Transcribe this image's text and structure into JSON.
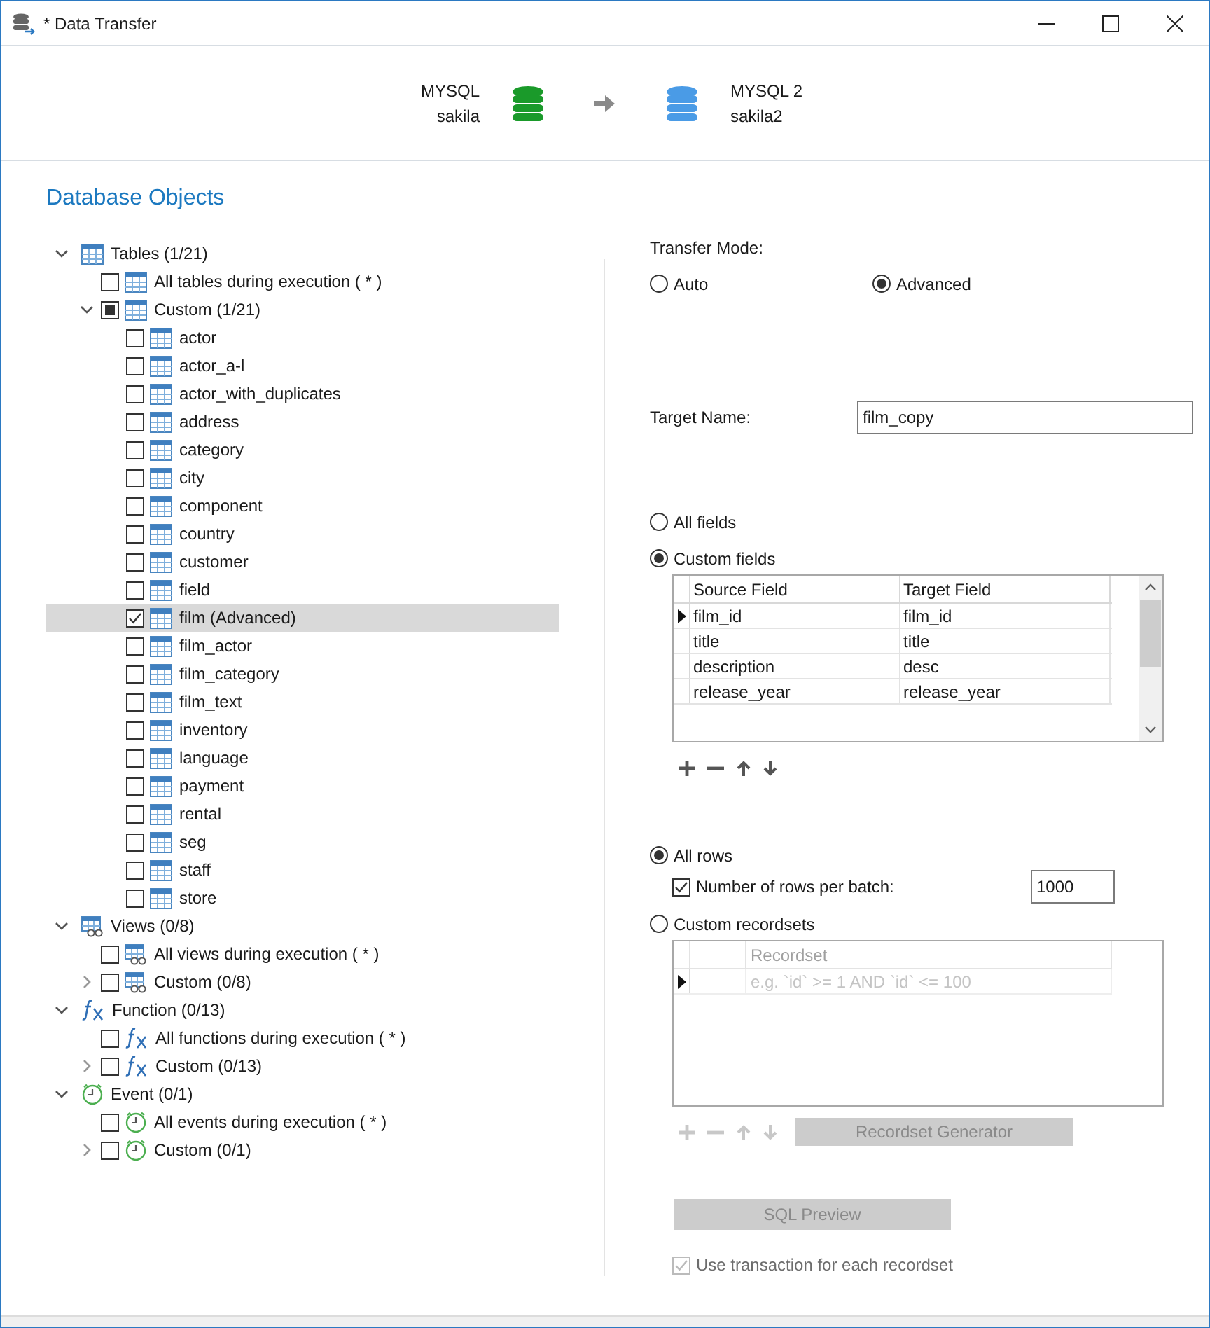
{
  "window": {
    "title": "* Data Transfer"
  },
  "connections": {
    "source": {
      "name": "MYSQL",
      "database": "sakila",
      "color": "#1a9a2a"
    },
    "target": {
      "name": "MYSQL 2",
      "database": "sakila2",
      "color": "#4a9be6"
    }
  },
  "objects": {
    "title": "Database Objects",
    "groups": [
      {
        "label": "Tables (1/21)",
        "kind": "table",
        "expanded": true,
        "children": [
          {
            "label": "All tables during execution ( * )",
            "checked": false,
            "indeterminate": false,
            "selected": false
          },
          {
            "label": "Custom (1/21)",
            "checked": false,
            "indeterminate": true,
            "selected": false,
            "expanded": true,
            "children": [
              {
                "label": "actor",
                "checked": false,
                "selected": false
              },
              {
                "label": "actor_a-l",
                "checked": false,
                "selected": false
              },
              {
                "label": "actor_with_duplicates",
                "checked": false,
                "selected": false
              },
              {
                "label": "address",
                "checked": false,
                "selected": false
              },
              {
                "label": "category",
                "checked": false,
                "selected": false
              },
              {
                "label": "city",
                "checked": false,
                "selected": false
              },
              {
                "label": "component",
                "checked": false,
                "selected": false
              },
              {
                "label": "country",
                "checked": false,
                "selected": false
              },
              {
                "label": "customer",
                "checked": false,
                "selected": false
              },
              {
                "label": "field",
                "checked": false,
                "selected": false
              },
              {
                "label": "film (Advanced)",
                "checked": true,
                "selected": true
              },
              {
                "label": "film_actor",
                "checked": false,
                "selected": false
              },
              {
                "label": "film_category",
                "checked": false,
                "selected": false
              },
              {
                "label": "film_text",
                "checked": false,
                "selected": false
              },
              {
                "label": "inventory",
                "checked": false,
                "selected": false
              },
              {
                "label": "language",
                "checked": false,
                "selected": false
              },
              {
                "label": "payment",
                "checked": false,
                "selected": false
              },
              {
                "label": "rental",
                "checked": false,
                "selected": false
              },
              {
                "label": "seg",
                "checked": false,
                "selected": false
              },
              {
                "label": "staff",
                "checked": false,
                "selected": false
              },
              {
                "label": "store",
                "checked": false,
                "selected": false
              }
            ]
          }
        ]
      },
      {
        "label": "Views (0/8)",
        "kind": "view",
        "expanded": true,
        "children": [
          {
            "label": "All views during execution ( * )",
            "checked": false,
            "indeterminate": false,
            "selected": false
          },
          {
            "label": "Custom (0/8)",
            "checked": false,
            "indeterminate": false,
            "selected": false,
            "expanded": false
          }
        ]
      },
      {
        "label": "Function (0/13)",
        "kind": "function",
        "expanded": true,
        "children": [
          {
            "label": "All functions during execution ( * )",
            "checked": false,
            "indeterminate": false,
            "selected": false
          },
          {
            "label": "Custom (0/13)",
            "checked": false,
            "indeterminate": false,
            "selected": false,
            "expanded": false
          }
        ]
      },
      {
        "label": "Event (0/1)",
        "kind": "event",
        "expanded": true,
        "children": [
          {
            "label": "All events during execution ( * )",
            "checked": false,
            "indeterminate": false,
            "selected": false
          },
          {
            "label": "Custom (0/1)",
            "checked": false,
            "indeterminate": false,
            "selected": false,
            "expanded": false
          }
        ]
      }
    ]
  },
  "transfer_mode": {
    "label": "Transfer Mode:",
    "options": [
      {
        "label": "Auto",
        "selected": false
      },
      {
        "label": "Advanced",
        "selected": true
      }
    ]
  },
  "target_name": {
    "label": "Target Name:",
    "value": "film_copy"
  },
  "fields": {
    "options": [
      {
        "label": "All fields",
        "selected": false
      },
      {
        "label": "Custom fields",
        "selected": true
      }
    ],
    "columns": [
      "Source Field",
      "Target Field"
    ],
    "rows": [
      {
        "source": "film_id",
        "target": "film_id",
        "current": true
      },
      {
        "source": "title",
        "target": "title",
        "current": false
      },
      {
        "source": "description",
        "target": "desc",
        "current": false
      },
      {
        "source": "release_year",
        "target": "release_year",
        "current": false
      }
    ],
    "tools_disabled": false
  },
  "rows_mode": {
    "all_rows": {
      "label": "All rows",
      "selected": true
    },
    "batch": {
      "label": "Number of rows per batch:",
      "checked": true,
      "value": "1000"
    },
    "custom": {
      "label": "Custom recordsets",
      "selected": false
    },
    "columns": [
      "Recordset"
    ],
    "rows": [
      {
        "placeholder": "e.g. `id` >= 1 AND `id` <= 100",
        "current": true
      }
    ],
    "tools_disabled": true,
    "generator": {
      "label": "Recordset Generator",
      "disabled": true
    }
  },
  "sql_preview": {
    "label": "SQL Preview",
    "disabled": true
  },
  "use_transaction": {
    "label": "Use transaction for each recordset",
    "checked": true,
    "disabled": true
  }
}
